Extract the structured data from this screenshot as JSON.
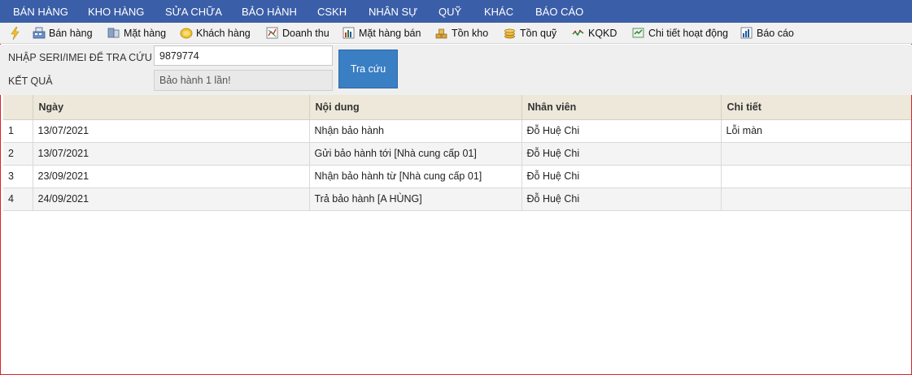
{
  "nav": {
    "items": [
      "BÁN HÀNG",
      "KHO HÀNG",
      "SỬA CHỮA",
      "BẢO HÀNH",
      "CSKH",
      "NHÂN SỰ",
      "QUỸ",
      "KHÁC",
      "BÁO CÁO"
    ]
  },
  "toolbar": {
    "items": [
      {
        "label": "Bán hàng",
        "icon": "cashier-icon"
      },
      {
        "label": "Mặt hàng",
        "icon": "product-icon"
      },
      {
        "label": "Khách hàng",
        "icon": "customer-icon"
      },
      {
        "label": "Doanh thu",
        "icon": "revenue-icon"
      },
      {
        "label": "Mặt hàng bán",
        "icon": "bar-chart-icon"
      },
      {
        "label": "Tồn kho",
        "icon": "stock-icon"
      },
      {
        "label": "Tồn quỹ",
        "icon": "coins-icon"
      },
      {
        "label": "KQKD",
        "icon": "line-chart-icon"
      },
      {
        "label": "Chi tiết hoạt động",
        "icon": "activity-icon"
      },
      {
        "label": "Báo cáo",
        "icon": "report-icon"
      }
    ]
  },
  "search": {
    "label": "NHẬP SERI/IMEI ĐỂ TRA CỨU",
    "value": "9879774",
    "result_label": "KẾT QUẢ",
    "result_value": "Bảo hành 1 lần!",
    "button_label": "Tra cứu"
  },
  "table": {
    "headers": [
      "",
      "Ngày",
      "Nội dung",
      "Nhân viên",
      "Chi tiết"
    ],
    "rows": [
      [
        "1",
        "13/07/2021",
        "Nhận bảo hành",
        "Đỗ Huệ Chi",
        "Lỗi màn"
      ],
      [
        "2",
        "13/07/2021",
        "Gửi bảo hành tới [Nhà cung cấp 01]",
        "Đỗ Huệ Chi",
        ""
      ],
      [
        "3",
        "23/09/2021",
        "Nhận bảo hành từ [Nhà cung cấp 01]",
        "Đỗ Huệ Chi",
        ""
      ],
      [
        "4",
        "24/09/2021",
        "Trả bảo hành [A HÙNG]",
        "Đỗ Huệ Chi",
        ""
      ]
    ]
  },
  "colors": {
    "nav_bg": "#3b5ea8",
    "button_bg": "#3a7ec4",
    "header_bg": "#ede8da",
    "frame_border": "#d9232d"
  }
}
